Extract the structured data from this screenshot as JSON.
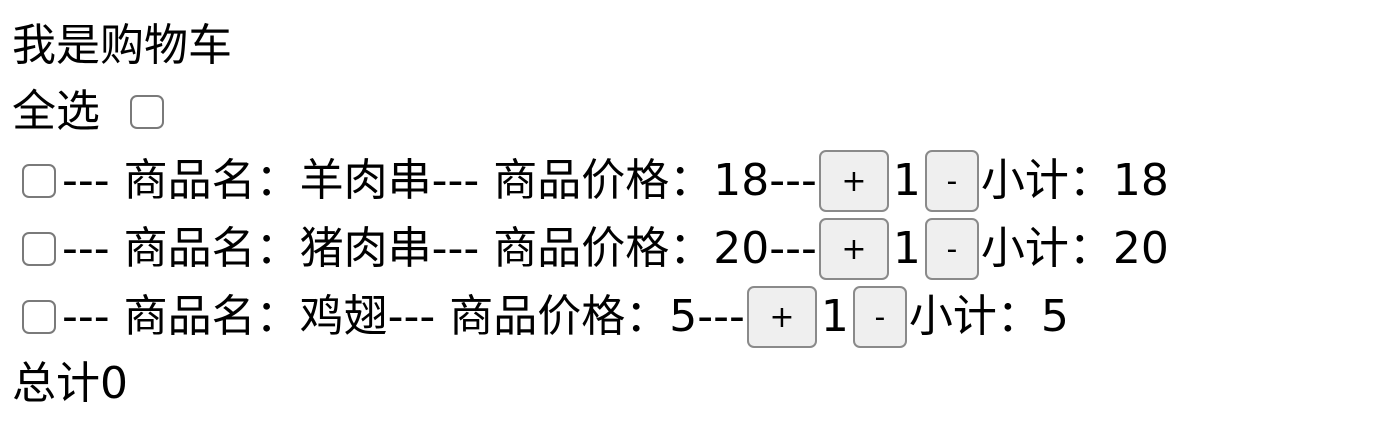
{
  "title": "我是购物车",
  "select_all": {
    "label": "全选",
    "checked": false
  },
  "items": [
    {
      "name_prefix": "--- 商品名：",
      "name": "羊肉串",
      "price_prefix": "--- 商品价格：",
      "price": "18",
      "sep": "---",
      "plus": "+",
      "quantity": "1",
      "minus": "-",
      "subtotal_label": "小计：",
      "subtotal": "18",
      "checked": false
    },
    {
      "name_prefix": "--- 商品名：",
      "name": "猪肉串",
      "price_prefix": "--- 商品价格：",
      "price": "20",
      "sep": "---",
      "plus": "+",
      "quantity": "1",
      "minus": "-",
      "subtotal_label": "小计：",
      "subtotal": "20",
      "checked": false
    },
    {
      "name_prefix": "--- 商品名：",
      "name": "鸡翅",
      "price_prefix": "--- 商品价格：",
      "price": "5",
      "sep": "---",
      "plus": "+",
      "quantity": "1",
      "minus": "-",
      "subtotal_label": "小计：",
      "subtotal": "5",
      "checked": false
    }
  ],
  "total": {
    "label": "总计",
    "value": "0"
  }
}
